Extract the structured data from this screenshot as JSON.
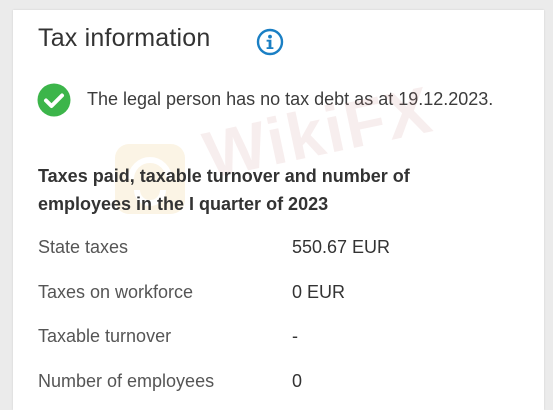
{
  "card": {
    "title": "Tax information",
    "status_text": "The legal person has no tax debt as at 19.12.2023.",
    "section_heading": "Taxes paid, taxable turnover and number of employees in the I quarter of 2023",
    "rows": [
      {
        "label": "State taxes",
        "value": "550.67 EUR"
      },
      {
        "label": "Taxes on workforce",
        "value": "0 EUR"
      },
      {
        "label": "Taxable turnover",
        "value": "-"
      },
      {
        "label": "Number of employees",
        "value": "0"
      }
    ]
  },
  "watermark": {
    "text": "WikiFX"
  },
  "icons": {
    "info": "info-icon",
    "status": "check-circle-icon"
  },
  "colors": {
    "info_blue": "#1a7fc4",
    "success_green": "#3cb54a",
    "watermark": "#c98080"
  }
}
